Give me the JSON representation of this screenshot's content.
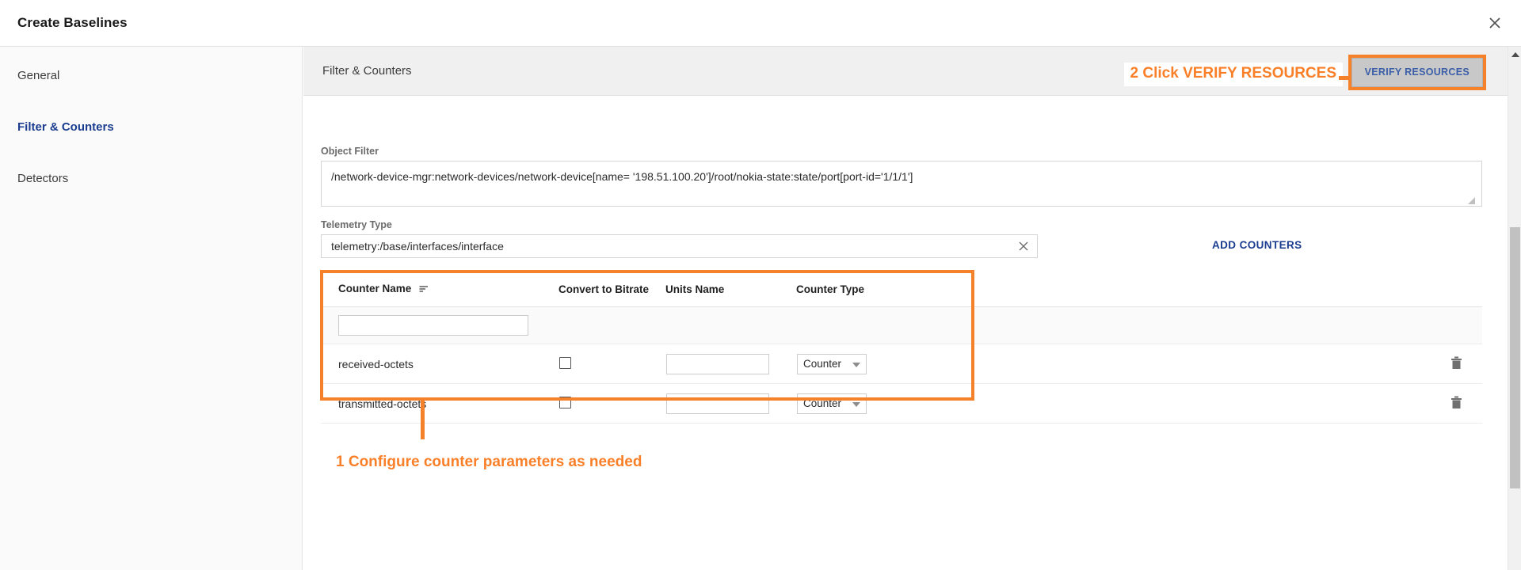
{
  "window": {
    "title": "Create Baselines",
    "close_icon": "close-icon"
  },
  "sidebar": {
    "items": [
      {
        "label": "General",
        "active": false
      },
      {
        "label": "Filter & Counters",
        "active": true
      },
      {
        "label": "Detectors",
        "active": false
      }
    ]
  },
  "content": {
    "header_title": "Filter & Counters",
    "verify_button_label": "VERIFY RESOURCES",
    "add_counters_label": "ADD COUNTERS"
  },
  "object_filter": {
    "label": "Object Filter",
    "value": "/network-device-mgr:network-devices/network-device[name= '198.51.100.20']/root/nokia-state:state/port[port-id='1/1/1']",
    "placeholder": ""
  },
  "telemetry_type": {
    "label": "Telemetry Type",
    "value": "telemetry:/base/interfaces/interface",
    "clear_icon": "clear-x-icon"
  },
  "counters_table": {
    "columns": [
      "Counter Name",
      "Convert to Bitrate",
      "Units Name",
      "Counter Type"
    ],
    "sort_icon": "sort-icon",
    "filter_row": {
      "counter_name_filter": "",
      "counter_name_filter_placeholder": ""
    },
    "rows": [
      {
        "counter_name": "received-octets",
        "convert_to_bitrate": false,
        "units_name": "",
        "units_name_placeholder": "",
        "counter_type": "Counter",
        "delete_icon": "trash-icon"
      },
      {
        "counter_name": "transmitted-octets",
        "convert_to_bitrate": false,
        "units_name": "",
        "units_name_placeholder": "",
        "counter_type": "Counter",
        "delete_icon": "trash-icon"
      }
    ]
  },
  "annotations": {
    "step1": "1 Configure counter parameters as needed",
    "step2": "2 Click VERIFY RESOURCES",
    "color": "#f5822a"
  },
  "scrollbar": {
    "up_arrow_icon": "scroll-up-arrow-icon"
  }
}
